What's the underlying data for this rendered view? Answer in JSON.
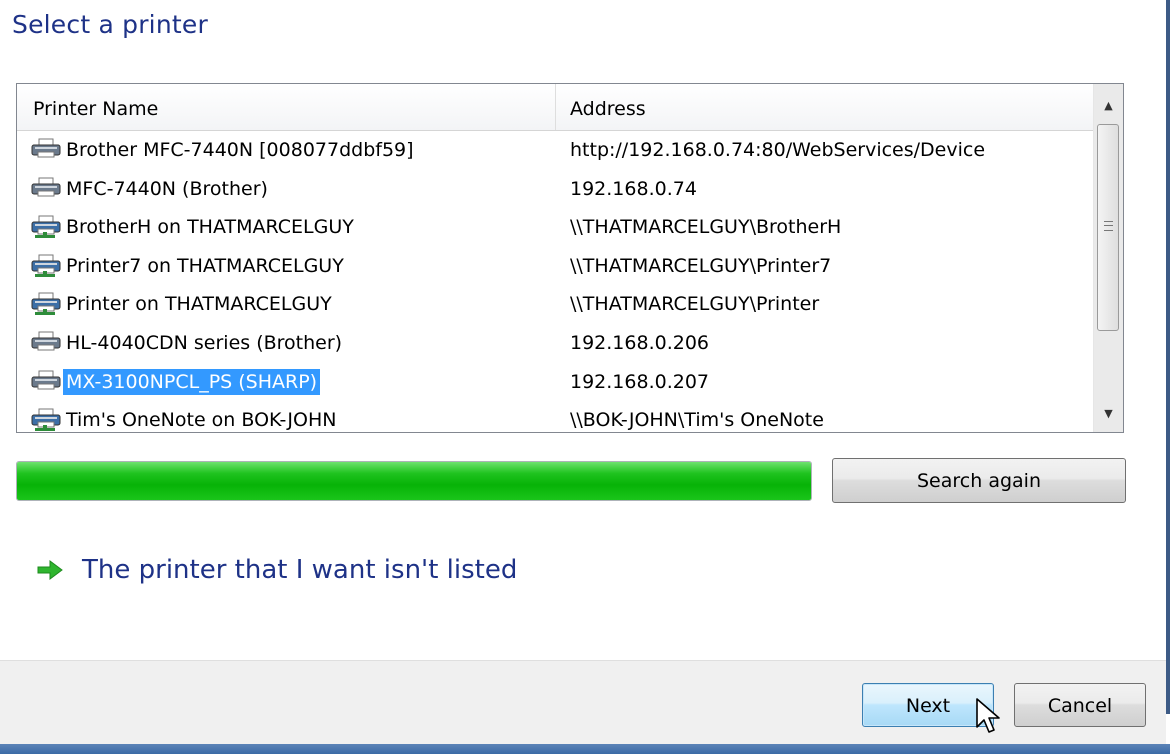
{
  "header": {
    "title": "Select a printer"
  },
  "printer_list": {
    "columns": {
      "name": "Printer Name",
      "address": "Address"
    },
    "rows": [
      {
        "name": "Brother MFC-7440N [008077ddbf59]",
        "address": "http://192.168.0.74:80/WebServices/Device",
        "icon": "local-printer-icon",
        "selected": false
      },
      {
        "name": "MFC-7440N (Brother)",
        "address": "192.168.0.74",
        "icon": "local-printer-icon",
        "selected": false
      },
      {
        "name": "BrotherH on THATMARCELGUY",
        "address": "\\\\THATMARCELGUY\\BrotherH",
        "icon": "network-printer-icon",
        "selected": false
      },
      {
        "name": "Printer7 on THATMARCELGUY",
        "address": "\\\\THATMARCELGUY\\Printer7",
        "icon": "network-printer-icon",
        "selected": false
      },
      {
        "name": "Printer on THATMARCELGUY",
        "address": "\\\\THATMARCELGUY\\Printer",
        "icon": "network-printer-icon",
        "selected": false
      },
      {
        "name": "HL-4040CDN series (Brother)",
        "address": "192.168.0.206",
        "icon": "local-printer-icon",
        "selected": false
      },
      {
        "name": "MX-3100NPCL_PS (SHARP)",
        "address": "192.168.0.207",
        "icon": "local-printer-icon",
        "selected": true
      },
      {
        "name": "Tim's OneNote on BOK-JOHN",
        "address": "\\\\BOK-JOHN\\Tim's OneNote",
        "icon": "network-printer-icon",
        "selected": false
      }
    ]
  },
  "search": {
    "progress_fraction": 1.0,
    "button_label": "Search again"
  },
  "not_listed_link": {
    "text": "The printer that I want isn't listed",
    "icon": "green-arrow-icon"
  },
  "footer": {
    "next_label": "Next",
    "cancel_label": "Cancel"
  },
  "colors": {
    "title": "#1e3287",
    "selection": "#3399ff",
    "progress": "#07b307"
  }
}
